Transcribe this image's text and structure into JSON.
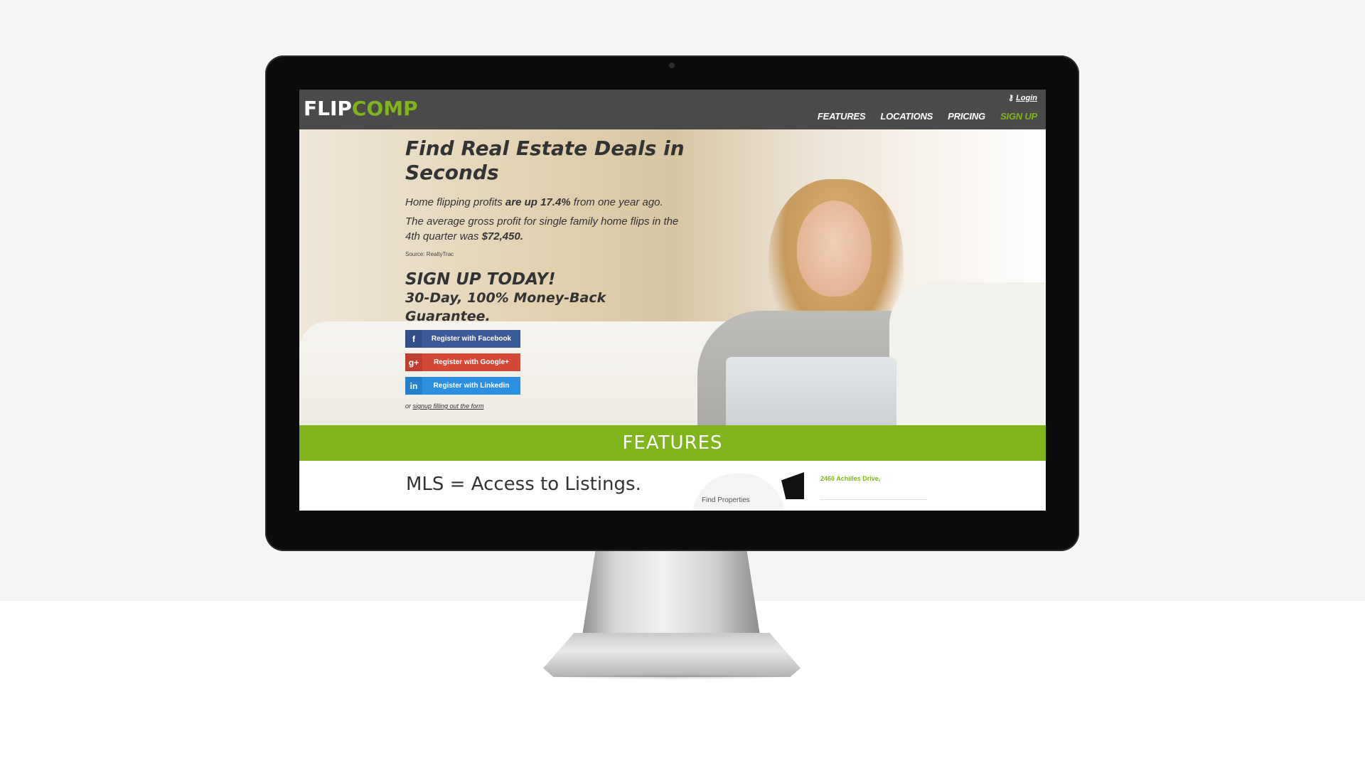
{
  "brand": {
    "logo_part1": "FLIP",
    "logo_part2": "COMP",
    "accent_color": "#7fb51a",
    "nav_bg": "#4a4a4b"
  },
  "nav": {
    "login_label": "Login",
    "login_icon": "key-icon",
    "items": [
      {
        "label": "FEATURES"
      },
      {
        "label": "LOCATIONS"
      },
      {
        "label": "PRICING"
      },
      {
        "label": "SIGN UP"
      }
    ]
  },
  "hero": {
    "headline": "Find Real Estate Deals in Seconds",
    "stat1_before": "Home flipping profits ",
    "stat1_bold": "are up 17.4%",
    "stat1_after": " from one year ago.",
    "stat2_before": "The average gross profit for single family home flips in the 4th quarter was ",
    "stat2_bold": "$72,450.",
    "source": "Source: RealtyTrac",
    "signup_title": "SIGN UP TODAY!",
    "guarantee": "30-Day, 100% Money-Back Guarantee.",
    "buttons": [
      {
        "icon": "facebook-icon",
        "glyph": "f",
        "label": "Register with Facebook",
        "color": "#3b5998"
      },
      {
        "icon": "google-plus-icon",
        "glyph": "g+",
        "label": "Register with Google+",
        "color": "#d34836"
      },
      {
        "icon": "linkedin-icon",
        "glyph": "in",
        "label": "Register with Linkedin",
        "color": "#2d8fe0"
      }
    ],
    "or_text": "or ",
    "form_link": "signup filling out the form"
  },
  "features": {
    "title": "FEATURES",
    "heading": "MLS = Access to Listings.",
    "preview_find": "Find Properties",
    "preview_address": "2460 Achilles Drive,"
  }
}
